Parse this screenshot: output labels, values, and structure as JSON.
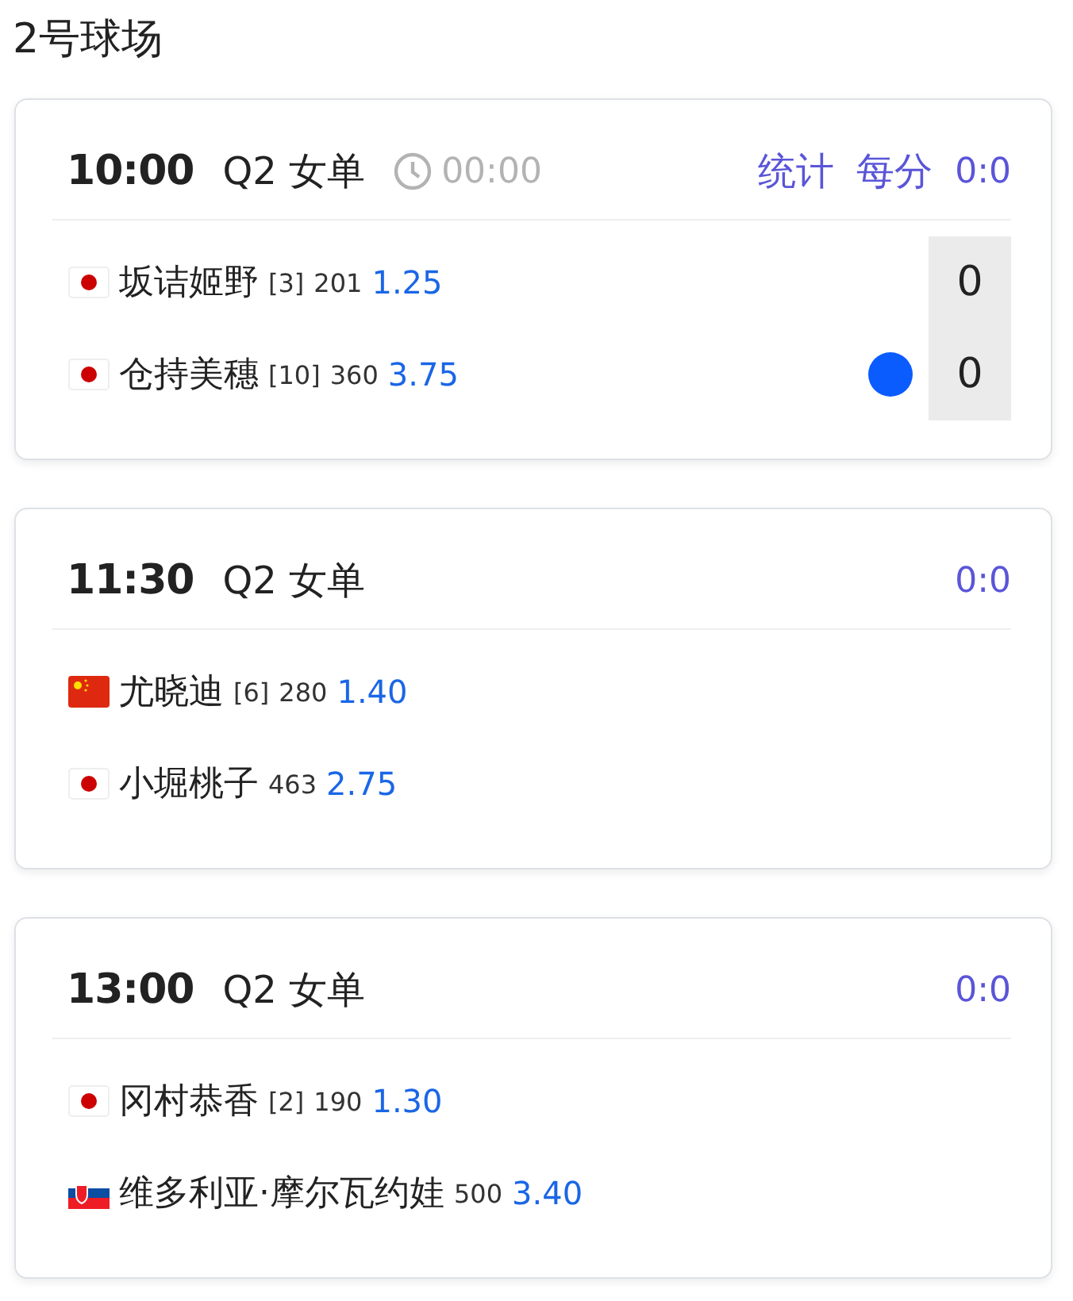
{
  "court": {
    "title": "2号球场"
  },
  "matches": [
    {
      "time": "10:00",
      "round": "Q2",
      "event": "女单",
      "clock": "00:00",
      "links": [
        "统计",
        "每分"
      ],
      "score": "0:0",
      "players": [
        {
          "flag": {
            "kind": "jp"
          },
          "name": "坂诘姬野",
          "seed": "[3]",
          "rank": "201",
          "odds": "1.25",
          "serving": false,
          "points": "0"
        },
        {
          "flag": {
            "kind": "jp"
          },
          "name": "仓持美穗",
          "seed": "[10]",
          "rank": "360",
          "odds": "3.75",
          "serving": true,
          "points": "0"
        }
      ]
    },
    {
      "time": "11:30",
      "round": "Q2",
      "event": "女单",
      "score": "0:0",
      "players": [
        {
          "flag": {
            "kind": "cn"
          },
          "name": "尤晓迪",
          "seed": "[6]",
          "rank": "280",
          "odds": "1.40",
          "serving": false
        },
        {
          "flag": {
            "kind": "jp"
          },
          "name": "小堀桃子",
          "rank": "463",
          "odds": "2.75",
          "serving": false
        }
      ]
    },
    {
      "time": "13:00",
      "round": "Q2",
      "event": "女单",
      "score": "0:0",
      "players": [
        {
          "flag": {
            "kind": "jp"
          },
          "name": "冈村恭香",
          "seed": "[2]",
          "rank": "190",
          "odds": "1.30",
          "serving": false
        },
        {
          "flag": {
            "kind": "sk"
          },
          "name": "维多利亚·摩尔瓦约娃",
          "rank": "500",
          "odds": "3.40",
          "serving": false
        }
      ]
    }
  ]
}
